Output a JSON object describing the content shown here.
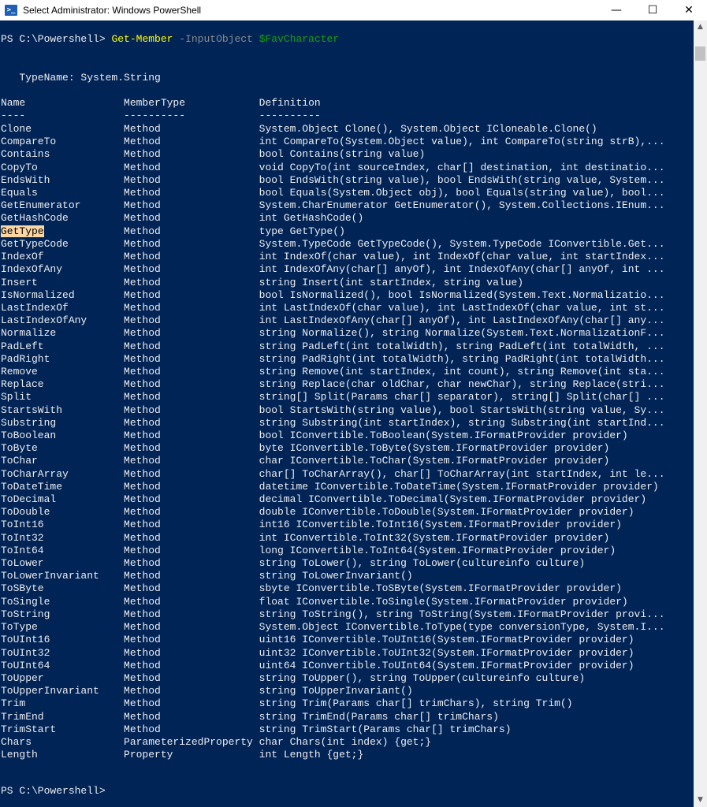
{
  "window": {
    "title": "Select Administrator: Windows PowerShell",
    "icon": "powershell-icon",
    "controls": {
      "minimize": "—",
      "maximize": "☐",
      "close": "✕"
    }
  },
  "console": {
    "prompt": "PS C:\\Powershell> ",
    "command": {
      "cmdlet": "Get-Member",
      "parameter": "-InputObject",
      "variable": "$FavCharacter"
    },
    "typename_line": "   TypeName: System.String",
    "header_line": "Name                MemberType            Definition",
    "separator_line": "----                ----------            ----------",
    "rows_before_highlight": "Clone               Method                System.Object Clone(), System.Object ICloneable.Clone()\nCompareTo           Method                int CompareTo(System.Object value), int CompareTo(string strB),...\nContains            Method                bool Contains(string value)\nCopyTo              Method                void CopyTo(int sourceIndex, char[] destination, int destinatio...\nEndsWith            Method                bool EndsWith(string value), bool EndsWith(string value, System...\nEquals              Method                bool Equals(System.Object obj), bool Equals(string value), bool...\nGetEnumerator       Method                System.CharEnumerator GetEnumerator(), System.Collections.IEnum...\nGetHashCode         Method                int GetHashCode()",
    "highlighted_name": "GetType",
    "highlighted_rest": "             Method                type GetType()",
    "rows_after_highlight": "GetTypeCode         Method                System.TypeCode GetTypeCode(), System.TypeCode IConvertible.Get...\nIndexOf             Method                int IndexOf(char value), int IndexOf(char value, int startIndex...\nIndexOfAny          Method                int IndexOfAny(char[] anyOf), int IndexOfAny(char[] anyOf, int ...\nInsert              Method                string Insert(int startIndex, string value)\nIsNormalized        Method                bool IsNormalized(), bool IsNormalized(System.Text.Normalizatio...\nLastIndexOf         Method                int LastIndexOf(char value), int LastIndexOf(char value, int st...\nLastIndexOfAny      Method                int LastIndexOfAny(char[] anyOf), int LastIndexOfAny(char[] any...\nNormalize           Method                string Normalize(), string Normalize(System.Text.NormalizationF...\nPadLeft             Method                string PadLeft(int totalWidth), string PadLeft(int totalWidth, ...\nPadRight            Method                string PadRight(int totalWidth), string PadRight(int totalWidth...\nRemove              Method                string Remove(int startIndex, int count), string Remove(int sta...\nReplace             Method                string Replace(char oldChar, char newChar), string Replace(stri...\nSplit               Method                string[] Split(Params char[] separator), string[] Split(char[] ...\nStartsWith          Method                bool StartsWith(string value), bool StartsWith(string value, Sy...\nSubstring           Method                string Substring(int startIndex), string Substring(int startInd...\nToBoolean           Method                bool IConvertible.ToBoolean(System.IFormatProvider provider)\nToByte              Method                byte IConvertible.ToByte(System.IFormatProvider provider)\nToChar              Method                char IConvertible.ToChar(System.IFormatProvider provider)\nToCharArray         Method                char[] ToCharArray(), char[] ToCharArray(int startIndex, int le...\nToDateTime          Method                datetime IConvertible.ToDateTime(System.IFormatProvider provider)\nToDecimal           Method                decimal IConvertible.ToDecimal(System.IFormatProvider provider)\nToDouble            Method                double IConvertible.ToDouble(System.IFormatProvider provider)\nToInt16             Method                int16 IConvertible.ToInt16(System.IFormatProvider provider)\nToInt32             Method                int IConvertible.ToInt32(System.IFormatProvider provider)\nToInt64             Method                long IConvertible.ToInt64(System.IFormatProvider provider)\nToLower             Method                string ToLower(), string ToLower(cultureinfo culture)\nToLowerInvariant    Method                string ToLowerInvariant()\nToSByte             Method                sbyte IConvertible.ToSByte(System.IFormatProvider provider)\nToSingle            Method                float IConvertible.ToSingle(System.IFormatProvider provider)\nToString            Method                string ToString(), string ToString(System.IFormatProvider provi...\nToType              Method                System.Object IConvertible.ToType(type conversionType, System.I...\nToUInt16            Method                uint16 IConvertible.ToUInt16(System.IFormatProvider provider)\nToUInt32            Method                uint32 IConvertible.ToUInt32(System.IFormatProvider provider)\nToUInt64            Method                uint64 IConvertible.ToUInt64(System.IFormatProvider provider)\nToUpper             Method                string ToUpper(), string ToUpper(cultureinfo culture)\nToUpperInvariant    Method                string ToUpperInvariant()\nTrim                Method                string Trim(Params char[] trimChars), string Trim()\nTrimEnd             Method                string TrimEnd(Params char[] trimChars)\nTrimStart           Method                string TrimStart(Params char[] trimChars)\nChars               ParameterizedProperty char Chars(int index) {get;}\nLength              Property              int Length {get;}",
    "final_prompt": "PS C:\\Powershell>"
  },
  "scrollbar": {
    "up": "▲",
    "down": "▼"
  },
  "colors": {
    "console_bg": "#012456",
    "console_fg": "#eeedf0",
    "cmdlet": "#ffff00",
    "parameter": "#8b8b8b",
    "variable": "#13a10e",
    "selection": "#fbd7a3"
  }
}
